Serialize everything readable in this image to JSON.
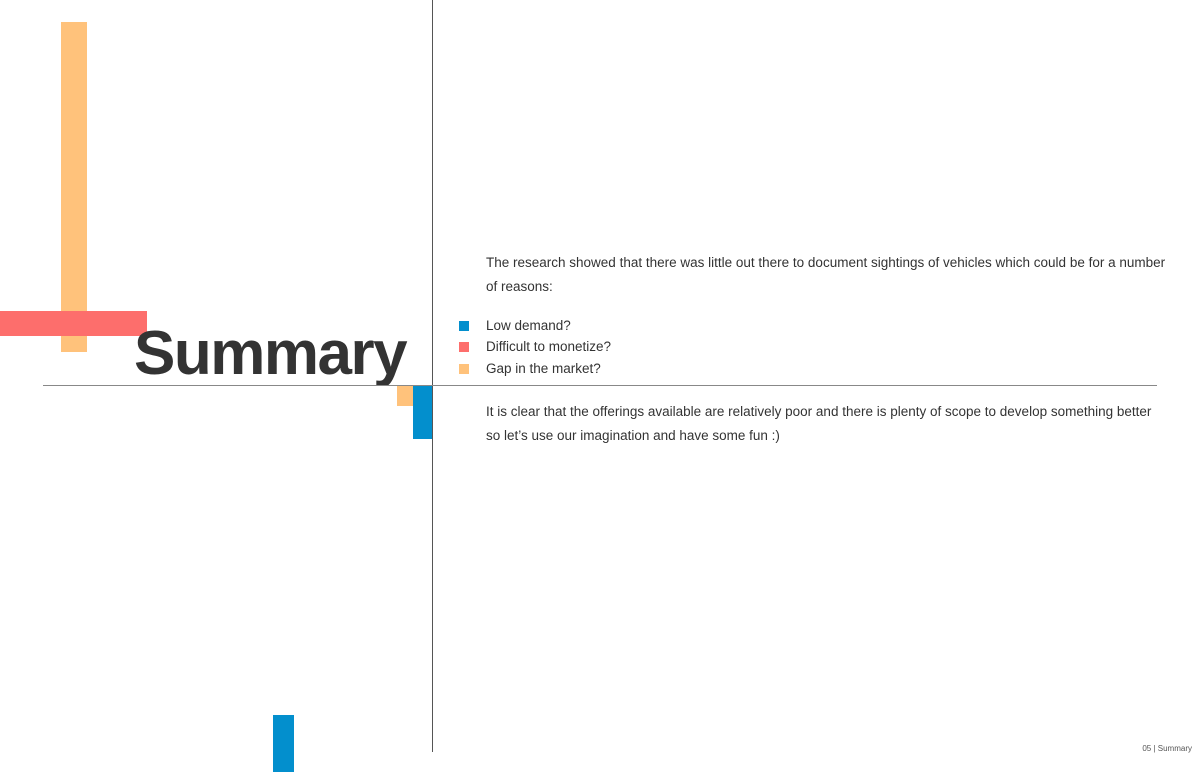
{
  "title": "Summary",
  "intro": "The research showed that there was little out there to document sightings of vehicles which could be for a number of reasons:",
  "bullets": [
    {
      "label": "Low demand?",
      "color": "#038fcd"
    },
    {
      "label": "Difficult to monetize?",
      "color": "#fd6e6c"
    },
    {
      "label": "Gap in the market?",
      "color": "#ffc27b"
    }
  ],
  "conclusion": "It is clear that the offerings available are relatively poor and there is plenty of scope to develop something better so let’s use our imagination and have some fun :)",
  "footer": "05 | Summary",
  "colors": {
    "blue": "#038fcd",
    "red": "#fd6e6c",
    "orange": "#ffc27b"
  }
}
